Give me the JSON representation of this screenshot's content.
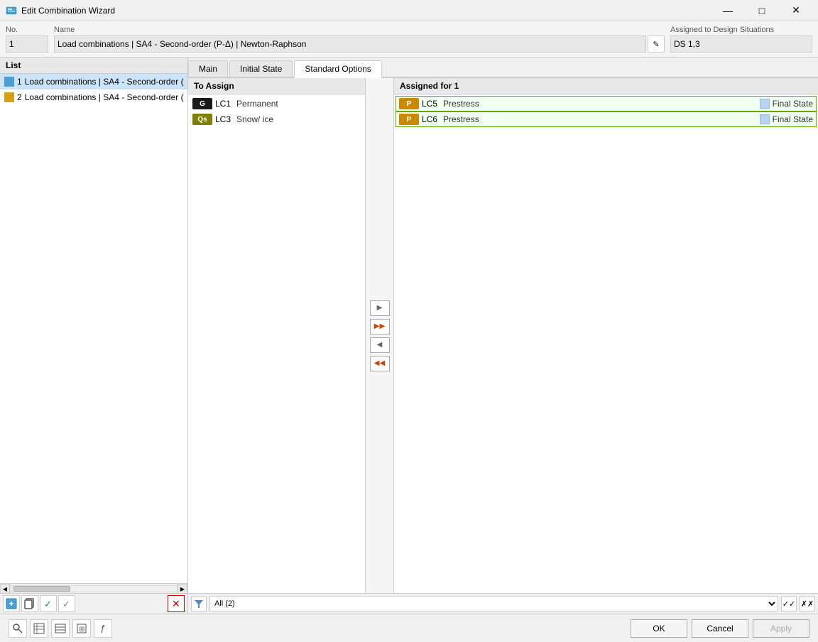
{
  "window": {
    "title": "Edit Combination Wizard",
    "min_label": "—",
    "max_label": "□",
    "close_label": "✕"
  },
  "header": {
    "list_label": "List",
    "no_label": "No.",
    "no_value": "1",
    "name_label": "Name",
    "name_value": "Load combinations | SA4 - Second-order (P-Δ) | Newton-Raphson",
    "assigned_label": "Assigned to Design Situations",
    "assigned_value": "DS 1,3"
  },
  "list_items": [
    {
      "id": 1,
      "text": "Load combinations | SA4 - Second-order (",
      "color": "blue"
    },
    {
      "id": 2,
      "text": "Load combinations | SA4 - Second-order (",
      "color": "yellow"
    }
  ],
  "tabs": [
    {
      "id": "main",
      "label": "Main",
      "active": false
    },
    {
      "id": "initial-state",
      "label": "Initial State",
      "active": false
    },
    {
      "id": "standard-options",
      "label": "Standard Options",
      "active": true
    }
  ],
  "to_assign": {
    "header": "To Assign",
    "items": [
      {
        "badge": "G",
        "badge_color": "black",
        "name": "LC1",
        "type": "Permanent"
      },
      {
        "badge": "Qs",
        "badge_color": "olive",
        "name": "LC3",
        "type": "Snow/ ice"
      }
    ]
  },
  "assigned": {
    "header": "Assigned for 1",
    "items": [
      {
        "badge": "P",
        "badge_color": "orange",
        "name": "LC5",
        "type": "Prestress",
        "state": "Final State",
        "highlighted": true
      },
      {
        "badge": "P",
        "badge_color": "orange",
        "name": "LC6",
        "type": "Prestress",
        "state": "Final State",
        "highlighted": true
      }
    ]
  },
  "transfer_buttons": {
    "right_single": "▶",
    "right_all": "▶▶",
    "left_single": "◀",
    "left_all": "◀◀"
  },
  "filter": {
    "label": "All (2)",
    "icon": "▼"
  },
  "bottom_toolbar": {
    "search_icon": "🔍",
    "table_icon": "▦",
    "box_icon": "□",
    "tree_icon": "⊞",
    "func_icon": "ƒ"
  },
  "buttons": {
    "ok": "OK",
    "cancel": "Cancel",
    "apply": "Apply"
  }
}
